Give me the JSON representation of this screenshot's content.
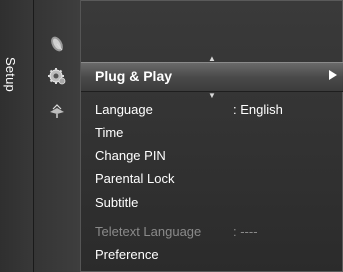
{
  "sidebar": {
    "tab_label": "Setup",
    "icons": [
      "satellite-dish-icon",
      "gear-icon",
      "signal-antenna-icon"
    ]
  },
  "menu": {
    "selected": {
      "label": "Plug & Play",
      "arrow": "right-arrow-icon"
    },
    "items": [
      {
        "label": "Language",
        "value": ": English",
        "enabled": true
      },
      {
        "label": "Time",
        "value": "",
        "enabled": true
      },
      {
        "label": "Change PIN",
        "value": "",
        "enabled": true
      },
      {
        "label": "Parental Lock",
        "value": "",
        "enabled": true
      },
      {
        "label": "Subtitle",
        "value": "",
        "enabled": true
      },
      {
        "label": "Teletext Language",
        "value": ": ----",
        "enabled": false
      },
      {
        "label": "Preference",
        "value": "",
        "enabled": true
      }
    ]
  },
  "colors": {
    "background": "#2b2b2b",
    "selected_bar": "#4a4a4a",
    "text": "#ffffff",
    "disabled_text": "#8a8a8a"
  }
}
